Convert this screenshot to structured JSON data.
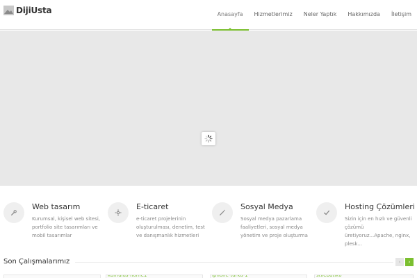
{
  "brand": {
    "name": "DijiUsta",
    "accent": "#7bbf2f"
  },
  "nav": {
    "items": [
      "Anasayfa",
      "Hizmetlerimiz",
      "Neler Yaptık",
      "Hakkımızda",
      "İletişim"
    ],
    "active_index": 0
  },
  "slider": {
    "state": "loading"
  },
  "features": [
    {
      "icon": "wrench-icon",
      "title": "Web tasarım",
      "text": "Kurumsal, kişisel web sitesi, portfolio site tasarımları ve mobil tasarımlar"
    },
    {
      "icon": "gear-icon",
      "title": "E-ticaret",
      "text": "e-ticaret projelerinin oluşturulması, denetim, test ve danışmanlık hizmetleri"
    },
    {
      "icon": "magic-wand-icon",
      "title": "Sosyal Medya",
      "text": "Sosyal medya pazarlama faaliyetleri, sosyal medya yönetim ve proje oluşturma"
    },
    {
      "icon": "checkmark-icon",
      "title": "Hosting Çözümleri",
      "text": "Sizin için en hızlı ve güvenli çözümü üretiyoruz...Apache, nginx, plesk..."
    }
  ],
  "works": {
    "title": "Son Çalışmalarımız",
    "prev_label": "‹",
    "next_label": "›",
    "items": [
      "",
      "kumulus-home1",
      "iphone-turka-1",
      "stilebutik0"
    ]
  }
}
